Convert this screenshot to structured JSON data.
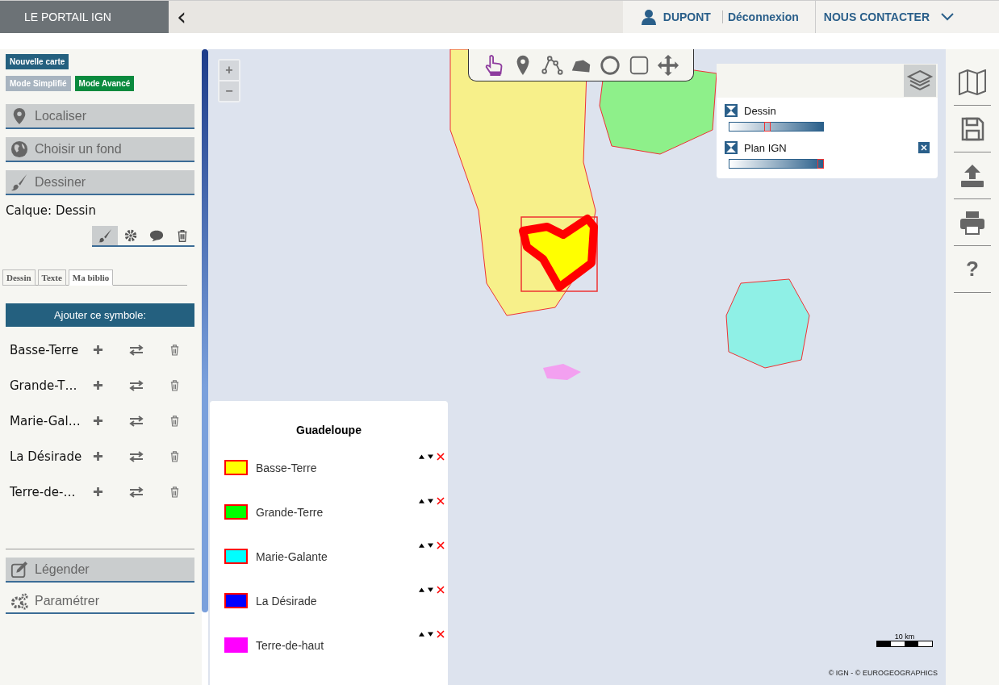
{
  "header": {
    "brand": "LE PORTAIL IGN",
    "collapse_glyph": "‹",
    "user": "DUPONT",
    "logout": "Déconnexion",
    "contact": "NOUS CONTACTER"
  },
  "sidebar": {
    "new_map": "Nouvelle carte",
    "modes": [
      {
        "label": "Mode Simplifié",
        "selected": false
      },
      {
        "label": "Mode Avancé",
        "selected": true
      }
    ],
    "top_sections": [
      {
        "kind": "pin",
        "label": "Localiser"
      },
      {
        "kind": "globe",
        "label": "Choisir un fond"
      },
      {
        "kind": "brush",
        "label": "Dessiner"
      }
    ],
    "layer_label": "Calque: Dessin",
    "layer_tools": [
      {
        "kind": "brush",
        "selected": true
      },
      {
        "kind": "gear",
        "selected": false
      },
      {
        "kind": "comment",
        "selected": false
      },
      {
        "kind": "trash",
        "selected": false
      }
    ],
    "tabs": [
      {
        "label": "Dessin",
        "selected": false
      },
      {
        "label": "Texte",
        "selected": false
      },
      {
        "label": "Ma biblio",
        "selected": true
      }
    ],
    "add_symbol": "Ajouter ce symbole:",
    "symbols": [
      "Basse-Terre",
      "Grande-T…",
      "Marie-Gal…",
      "La Désirade",
      "Terre-de-…"
    ],
    "bottom_sections": [
      {
        "kind": "edit",
        "label": "Légender"
      },
      {
        "kind": "gears",
        "label": "Paramétrer"
      }
    ]
  },
  "map": {
    "zoom": [
      "+",
      "−"
    ],
    "draw_tools": [
      {
        "kind": "pointer",
        "selected": true
      },
      {
        "kind": "pin",
        "selected": false
      },
      {
        "kind": "line",
        "selected": false
      },
      {
        "kind": "polygon",
        "selected": false
      },
      {
        "kind": "circle",
        "selected": false
      },
      {
        "kind": "square",
        "selected": false
      },
      {
        "kind": "move",
        "selected": false
      }
    ],
    "layers": [
      {
        "name": "Dessin",
        "level": 0.4,
        "removable": false
      },
      {
        "name": "Plan IGN",
        "level": 1,
        "removable": true
      }
    ],
    "legend": {
      "title": "Guadeloupe",
      "items": [
        {
          "label": "Basse-Terre",
          "color": "#ffff00",
          "outlined": true
        },
        {
          "label": "Grande-Terre",
          "color": "#00ff00",
          "outlined": true
        },
        {
          "label": "Marie-Galante",
          "color": "#00ffff",
          "outlined": true
        },
        {
          "label": "La Désirade",
          "color": "#0000ff",
          "outlined": true
        },
        {
          "label": "Terre-de-haut",
          "color": "#ff00ff",
          "outlined": false
        }
      ]
    },
    "scale": "10 km",
    "attribution": "© IGN - © EUROGEOGRAPHICS"
  },
  "right_toolbar": [
    {
      "kind": "map"
    },
    {
      "kind": "save"
    },
    {
      "kind": "upload"
    },
    {
      "kind": "print"
    },
    {
      "kind": "help",
      "glyph": "?"
    }
  ]
}
